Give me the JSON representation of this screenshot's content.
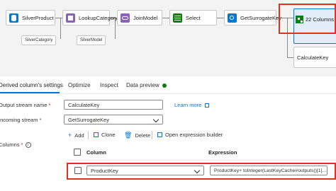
{
  "flow": {
    "nodes": [
      {
        "label": "SilverProduct",
        "icon": "database-icon"
      },
      {
        "label": "LookupCategory",
        "icon": "lookup-icon"
      },
      {
        "label": "JoinModel",
        "icon": "join-icon"
      },
      {
        "label": "Select",
        "icon": "select-icon"
      },
      {
        "label": "GetSurrogateKey",
        "icon": "surrogate-key-icon"
      }
    ],
    "sub_nodes": [
      "SilverCategory",
      "SilverModel"
    ],
    "selected_node": "22 Columns",
    "branch_node": "CalculateKey"
  },
  "tabs": [
    {
      "label": "Derived column's settings"
    },
    {
      "label": "Optimize"
    },
    {
      "label": "Inspect"
    },
    {
      "label": "Data preview"
    }
  ],
  "form": {
    "output_stream_label": "Output stream name",
    "output_stream_value": "CalculateKey",
    "learn_more": "Learn more",
    "incoming_stream_label": "Incoming stream",
    "incoming_stream_value": "GetSurrogateKey",
    "columns_label": "Columns"
  },
  "toolbar": {
    "add": "Add",
    "clone": "Clone",
    "delete": "Delete",
    "open_builder": "Open expression builder"
  },
  "table": {
    "headers": [
      "Column",
      "Expression"
    ],
    "rows": [
      {
        "column": "ProductKey",
        "expression": "ProductKey+ toInteger(LastKeyCache#outputs()[1]..."
      }
    ]
  },
  "colors": {
    "accent": "#0078d4",
    "highlight": "#e0301e",
    "status": "#107c10"
  }
}
